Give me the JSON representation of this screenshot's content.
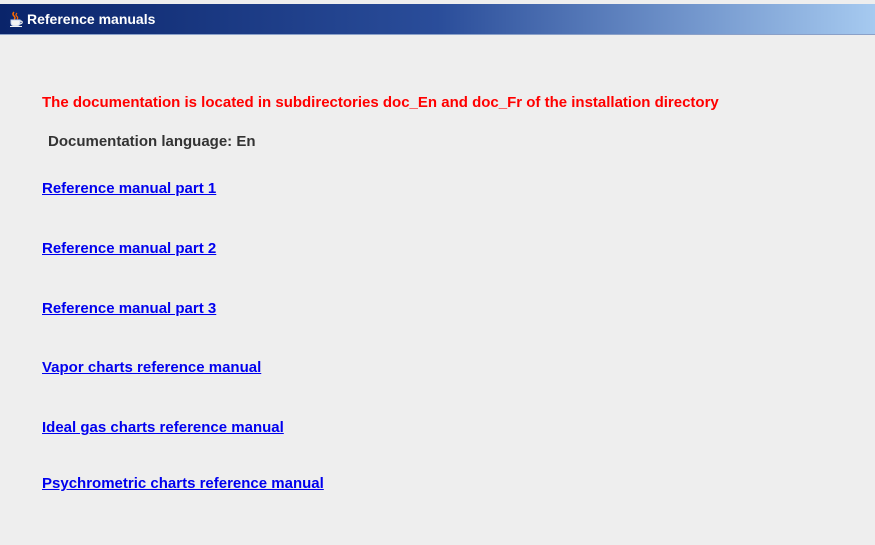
{
  "window": {
    "title": "Reference manuals",
    "icon": "java-cup-icon"
  },
  "content": {
    "notice": "The documentation is located in subdirectories doc_En and doc_Fr of the installation directory",
    "language_label": "Documentation language:",
    "language_value": "En",
    "links": [
      "Reference manual part 1",
      "Reference manual part 2",
      "Reference manual part 3",
      "Vapor charts reference manual",
      "Ideal gas charts reference manual",
      "Psychrometric charts reference manual"
    ]
  },
  "colors": {
    "notice": "#ff0000",
    "link": "#0000ee",
    "background": "#eeeeee",
    "titlebar_start": "#0a246a",
    "titlebar_end": "#a6caf0"
  }
}
